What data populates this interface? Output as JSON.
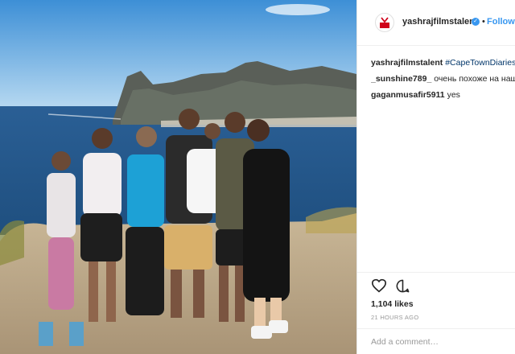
{
  "post": {
    "photo_alt": "",
    "account": {
      "username": "yashrajfilmstalent",
      "verified": true,
      "separator": "•",
      "follow_label": "Follow",
      "brand_color": "#d0021b"
    },
    "comments": [
      {
        "user": "yashrajfilmstalent",
        "text": "#CapeTownDiaries",
        "is_hashtag": true
      },
      {
        "user": "_sunshine789_",
        "text": "очень похоже на наш Ч",
        "is_hashtag": false
      },
      {
        "user": "gaganmusafir5911",
        "text": "yes",
        "is_hashtag": false
      }
    ],
    "likes_text": "1,104 likes",
    "timestamp": "21 HOURS AGO",
    "add_comment_placeholder": "Add a comment…"
  },
  "colors": {
    "link_blue": "#3897f0",
    "hashtag_blue": "#003569",
    "muted": "#999999",
    "text": "#262626"
  },
  "icons": {
    "like": "heart-icon",
    "comment": "comment-bubble-icon",
    "verified": "verified-badge-icon",
    "logo": "yrf-logo-icon"
  }
}
